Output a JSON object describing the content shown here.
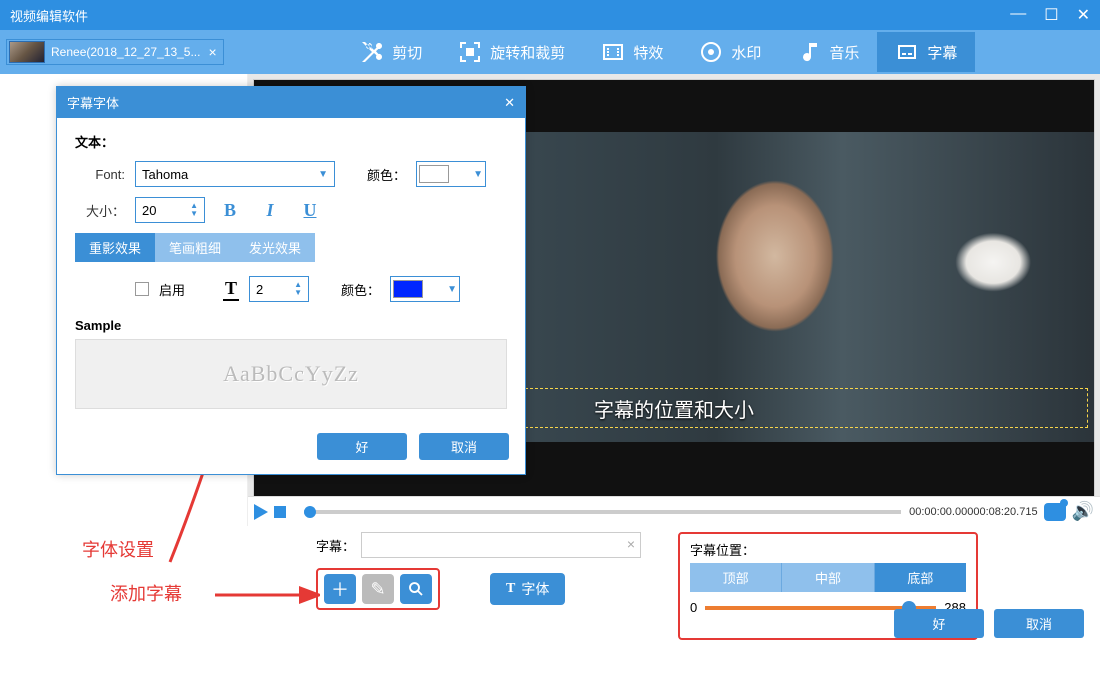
{
  "window": {
    "title": "视频编辑软件"
  },
  "fileTab": {
    "name": "Renee(2018_12_27_13_5..."
  },
  "tabs": {
    "cut": "剪切",
    "rotate": "旋转和裁剪",
    "effect": "特效",
    "watermark": "水印",
    "music": "音乐",
    "subtitle": "字幕"
  },
  "preview": {
    "subtitle_overlay": "字幕的位置和大小",
    "time_left": "00:00:00.000",
    "time_right": "00:08:20.715"
  },
  "subtitleBar": {
    "label": "字幕：",
    "font_button": "字体"
  },
  "position": {
    "label": "字幕位置：",
    "top": "顶部",
    "middle": "中部",
    "bottom": "底部",
    "min": "0",
    "max": "288"
  },
  "annotations": {
    "font_setting": "字体设置",
    "add_subtitle": "添加字幕"
  },
  "buttons": {
    "ok": "好",
    "cancel": "取消"
  },
  "dialog": {
    "title": "字幕字体",
    "text_label": "文本：",
    "font_label": "Font:",
    "font_value": "Tahoma",
    "color_label": "颜色：",
    "size_label": "大小：",
    "size_value": "20",
    "tabs": {
      "shadow": "重影效果",
      "stroke": "笔画粗细",
      "glow": "发光效果"
    },
    "enable_label": "启用",
    "stroke_value": "2",
    "color2_label": "颜色：",
    "color2_value": "#0026ff",
    "sample_label": "Sample",
    "sample_text": "AaBbCcYyZz",
    "ok": "好",
    "cancel": "取消"
  }
}
